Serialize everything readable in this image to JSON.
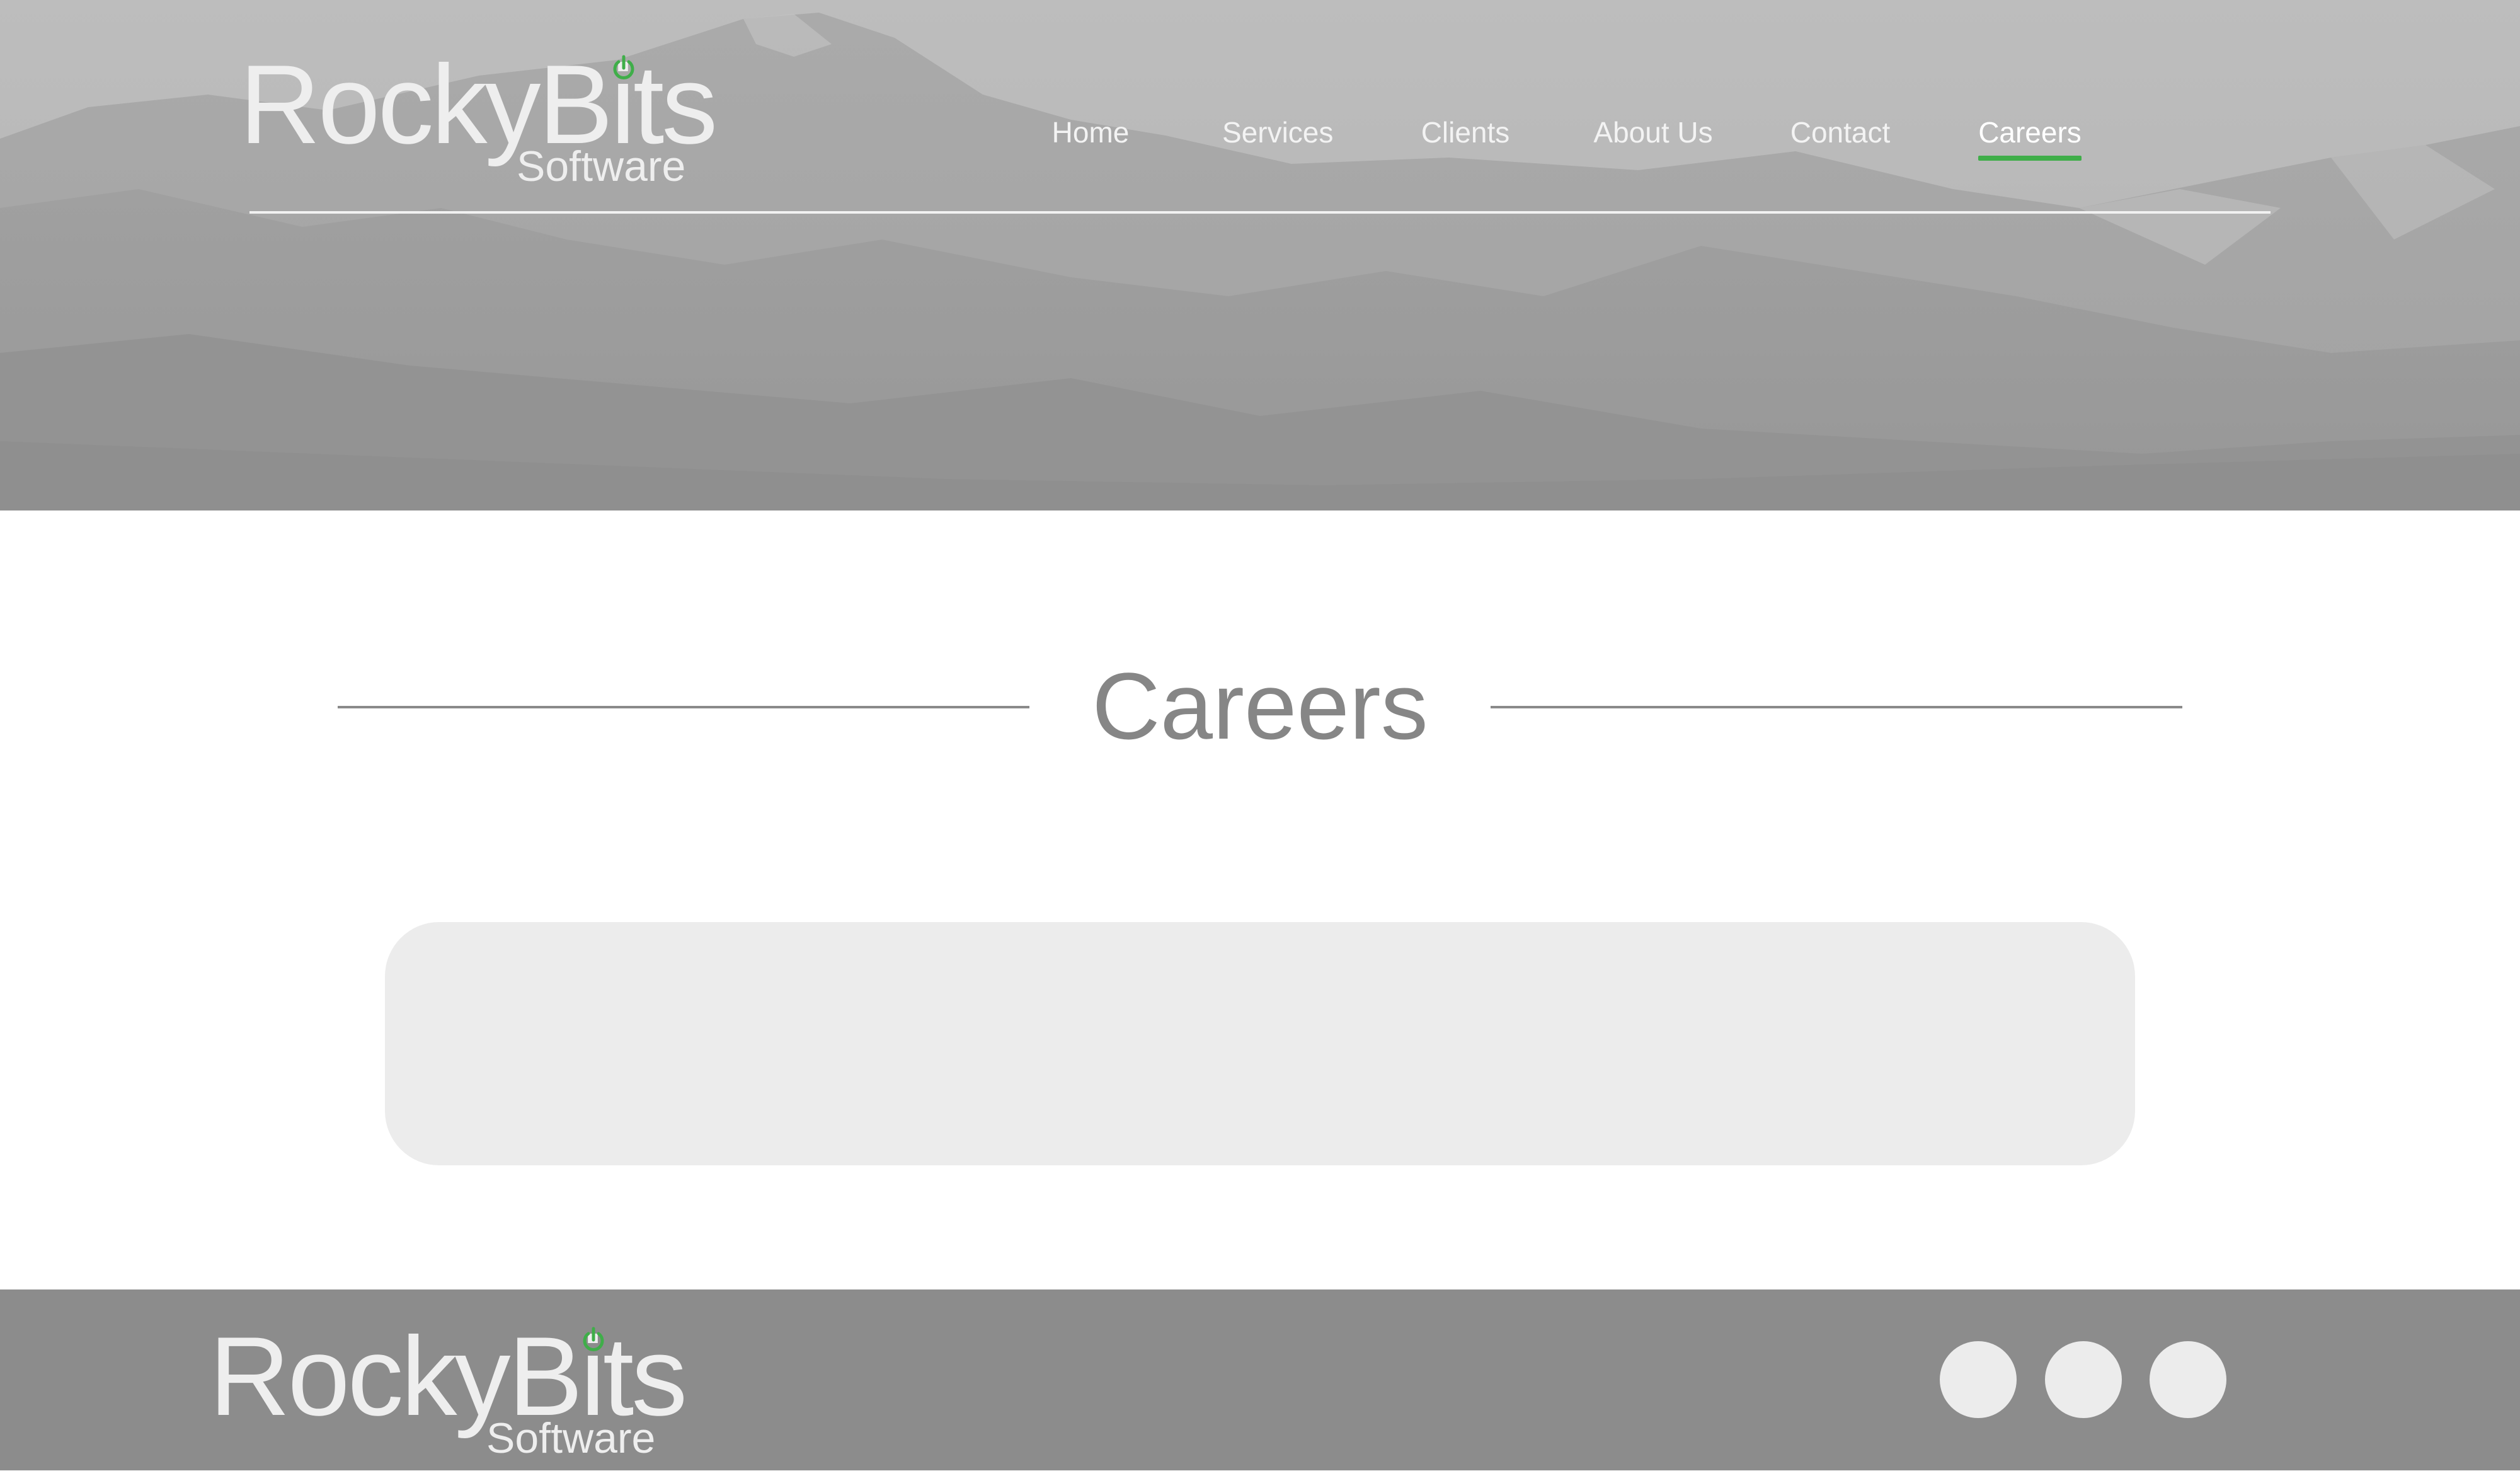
{
  "brand": {
    "name": "RockyBits",
    "tagline": "Software",
    "accent_color": "#3fae49",
    "logo_icon": "power-icon"
  },
  "nav": {
    "items": [
      {
        "label": "Home"
      },
      {
        "label": "Services"
      },
      {
        "label": "Clients"
      },
      {
        "label": "About Us"
      },
      {
        "label": "Contact"
      },
      {
        "label": "Careers",
        "active": true
      }
    ]
  },
  "hero": {
    "background": "mountain-landscape-image"
  },
  "main": {
    "title": "Careers",
    "card_content": ""
  },
  "footer": {
    "brand_name": "RockyBits",
    "brand_tagline": "Software",
    "social_icons": [
      "social-icon",
      "social-icon",
      "social-icon"
    ]
  }
}
